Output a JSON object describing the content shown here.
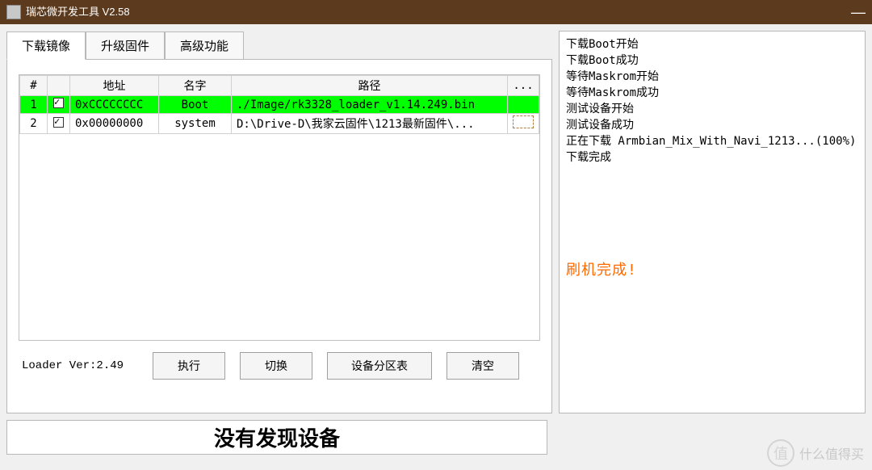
{
  "window": {
    "title": "瑞芯微开发工具 V2.58"
  },
  "tabs": {
    "download": "下载镜像",
    "upgrade": "升级固件",
    "advanced": "高级功能"
  },
  "table": {
    "headers": {
      "index": "#",
      "check": "",
      "address": "地址",
      "name": "名字",
      "path": "路径",
      "more": "..."
    },
    "rows": [
      {
        "index": "1",
        "checked": true,
        "address": "0xCCCCCCCC",
        "name": "Boot",
        "path": "./Image/rk3328_loader_v1.14.249.bin",
        "selected": true
      },
      {
        "index": "2",
        "checked": true,
        "address": "0x00000000",
        "name": "system",
        "path": "D:\\Drive-D\\我家云固件\\1213最新固件\\...",
        "selected": false
      }
    ]
  },
  "footer": {
    "loader_ver": "Loader Ver:2.49",
    "execute": "执行",
    "switch": "切换",
    "partition": "设备分区表",
    "clear": "清空"
  },
  "log": {
    "lines": [
      "下载Boot开始",
      "下载Boot成功",
      "等待Maskrom开始",
      "等待Maskrom成功",
      "测试设备开始",
      "测试设备成功",
      "正在下载 Armbian_Mix_With_Navi_1213...(100%)",
      "下载完成"
    ],
    "done": "刷机完成!"
  },
  "status": "没有发现设备",
  "watermark": {
    "badge": "值",
    "text": "什么值得买"
  }
}
